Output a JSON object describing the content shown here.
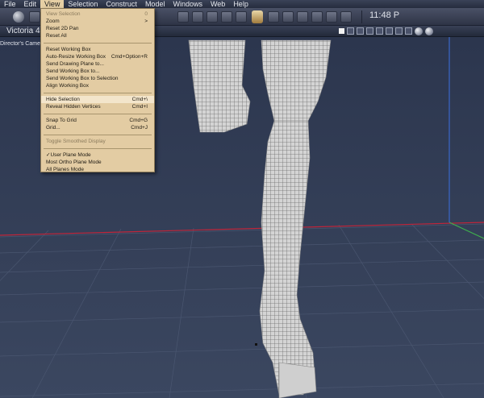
{
  "menubar": {
    "items": [
      {
        "label": "File"
      },
      {
        "label": "Edit"
      },
      {
        "label": "View"
      },
      {
        "label": "Selection"
      },
      {
        "label": "Construct"
      },
      {
        "label": "Model"
      },
      {
        "label": "Windows"
      },
      {
        "label": "Web"
      },
      {
        "label": "Help"
      }
    ]
  },
  "toolbar": {
    "clock": "11:48 P"
  },
  "viewport": {
    "title": "Victoria 4",
    "camera_label": "Director's Camera"
  },
  "view_menu": {
    "items": [
      {
        "label": "View Selection",
        "shortcut": "0",
        "disabled": true
      },
      {
        "label": "Zoom",
        "shortcut": ">",
        "disabled": false
      },
      {
        "label": "Reset 2D Pan",
        "shortcut": "",
        "disabled": false
      },
      {
        "label": "Reset All",
        "shortcut": "",
        "disabled": false
      },
      {
        "label": "Reset Working Box",
        "shortcut": "",
        "disabled": false
      },
      {
        "label": "Auto-Resize Working Box",
        "shortcut": "Cmd+Option+R",
        "disabled": false
      },
      {
        "label": "Send Drawing Plane to...",
        "shortcut": "",
        "disabled": false
      },
      {
        "label": "Send Working Box to...",
        "shortcut": "",
        "disabled": false
      },
      {
        "label": "Send Working Box to Selection",
        "shortcut": "",
        "disabled": false
      },
      {
        "label": "Align Working Box",
        "shortcut": "",
        "disabled": false
      },
      {
        "label": "Hide Selection",
        "shortcut": "Cmd+\\",
        "disabled": false
      },
      {
        "label": "Reveal Hidden Vertices",
        "shortcut": "Cmd+I",
        "disabled": false
      },
      {
        "label": "Snap To Grid",
        "shortcut": "Cmd+G",
        "disabled": false
      },
      {
        "label": "Grid...",
        "shortcut": "Cmd+J",
        "disabled": false
      },
      {
        "label": "Toggle Smoothed Display",
        "shortcut": "",
        "disabled": true
      },
      {
        "label": "✓User Plane Mode",
        "shortcut": "",
        "disabled": false
      },
      {
        "label": "Most Ortho Plane Mode",
        "shortcut": "",
        "disabled": false
      },
      {
        "label": "All Planes Mode",
        "shortcut": "",
        "disabled": false
      }
    ]
  }
}
